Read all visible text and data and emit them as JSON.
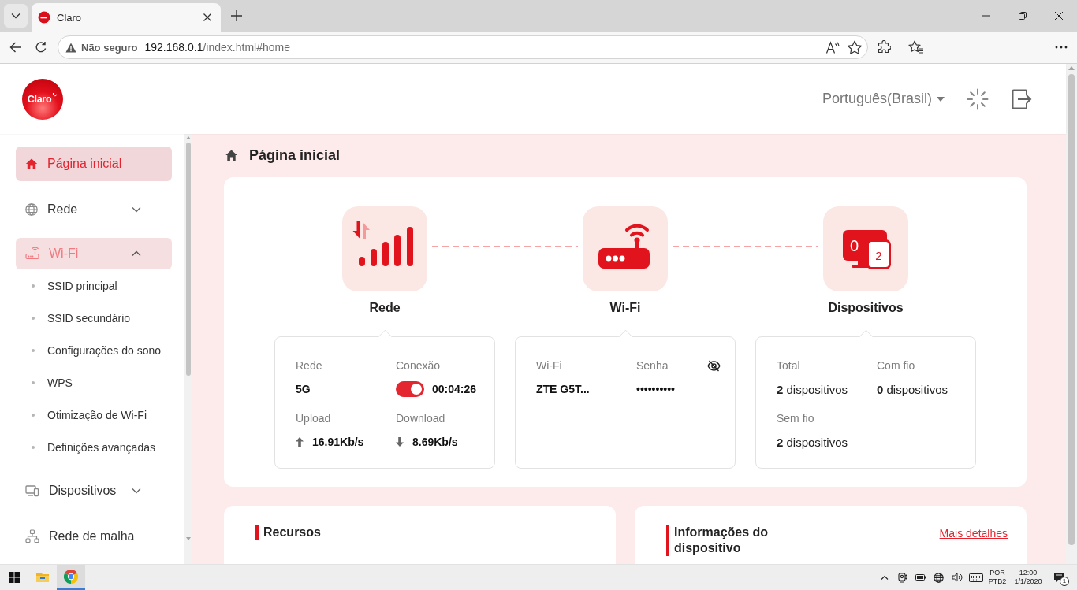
{
  "browser": {
    "tabs": [
      {
        "title": "Claro",
        "selected": true
      }
    ],
    "address": {
      "security": "Não seguro",
      "host": "192.168.0.1",
      "path": "/index.html#home"
    }
  },
  "header": {
    "logo": "Claro",
    "language": "Português(Brasil)"
  },
  "sidebar": {
    "items": [
      {
        "label": "Página inicial",
        "kind": "link",
        "selected": true
      },
      {
        "label": "Rede",
        "kind": "group",
        "selected": false,
        "expanded": false
      },
      {
        "label": "Wi-Fi",
        "kind": "group",
        "selected": false,
        "expanded": true,
        "children": [
          {
            "label": "SSID principal",
            "selected": false
          },
          {
            "label": "SSID secundário",
            "selected": false
          },
          {
            "label": "Configurações do sono",
            "selected": false
          },
          {
            "label": "WPS",
            "selected": false
          },
          {
            "label": "Otimização de Wi-Fi",
            "selected": false
          },
          {
            "label": "Definições avançadas",
            "selected": false
          }
        ]
      },
      {
        "label": "Dispositivos",
        "kind": "group",
        "selected": false,
        "expanded": false
      },
      {
        "label": "Rede de malha",
        "kind": "link",
        "selected": false
      }
    ]
  },
  "main": {
    "title": "Página inicial",
    "overview": {
      "nodes": [
        {
          "label": "Rede",
          "details": [
            {
              "label": "Rede",
              "value": "5G",
              "kind": "text"
            },
            {
              "label": "Conexão",
              "value": "00:04:26",
              "kind": "toggle",
              "on": true
            },
            {
              "label": "Upload",
              "value": "16.91Kb/s",
              "kind": "upload"
            },
            {
              "label": "Download",
              "value": "8.69Kb/s",
              "kind": "download"
            }
          ]
        },
        {
          "label": "Wi-Fi",
          "details": [
            {
              "label": "Wi-Fi",
              "value": "ZTE G5T...",
              "kind": "text"
            },
            {
              "label": "Senha",
              "value": "••••••••••",
              "kind": "password"
            }
          ]
        },
        {
          "label": "Dispositivos",
          "icon_counts": [
            "0",
            "2"
          ],
          "details": [
            {
              "label": "Total",
              "value": "**2** dispositivos",
              "kind": "count"
            },
            {
              "label": "Com fio",
              "value": "**0** dispositivos",
              "kind": "count"
            },
            {
              "label": "Sem fio",
              "value": "**2** dispositivos",
              "kind": "count"
            }
          ]
        }
      ]
    },
    "cards": [
      {
        "title": "Recursos"
      },
      {
        "title": "Informações do dispositivo",
        "link": "Mais detalhes"
      }
    ]
  },
  "taskbar": {
    "apps": [
      {
        "selected": false
      },
      {
        "selected": true
      }
    ],
    "input_language": [
      "POR",
      "PTB2"
    ],
    "time": "12:00",
    "date": "1/1/2020",
    "notifications": "1"
  }
}
